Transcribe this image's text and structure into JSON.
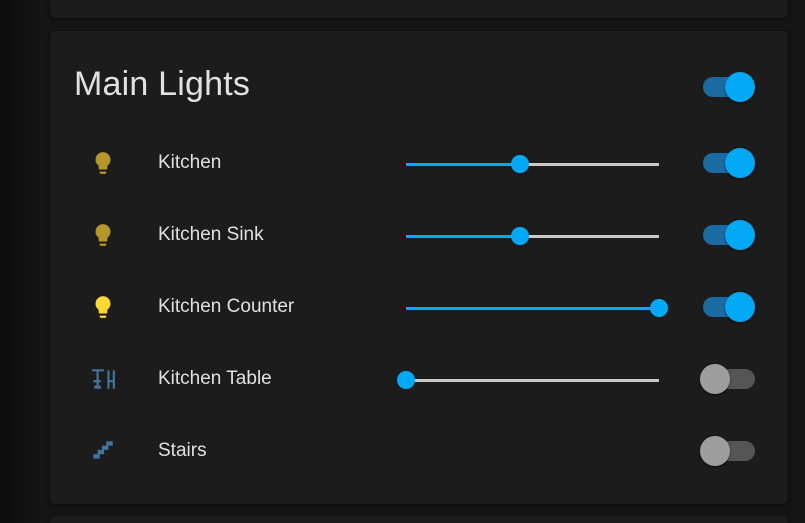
{
  "card": {
    "title": "Main Lights",
    "master_toggle_on": true
  },
  "rows": [
    {
      "label": "Kitchen",
      "icon": "lightbulb-icon",
      "icon_color": "#b8972a",
      "has_slider": true,
      "brightness_pct": 45,
      "on": true
    },
    {
      "label": "Kitchen Sink",
      "icon": "lightbulb-icon",
      "icon_color": "#b8972a",
      "has_slider": true,
      "brightness_pct": 45,
      "on": true
    },
    {
      "label": "Kitchen Counter",
      "icon": "lightbulb-icon",
      "icon_color": "#fdd835",
      "has_slider": true,
      "brightness_pct": 100,
      "on": true
    },
    {
      "label": "Kitchen Table",
      "icon": "table-chair-icon",
      "icon_color": "#44739e",
      "has_slider": true,
      "brightness_pct": 0,
      "on": false
    },
    {
      "label": "Stairs",
      "icon": "stairs-icon",
      "icon_color": "#44739e",
      "has_slider": false,
      "on": false
    }
  ],
  "colors": {
    "accent": "#03a9f4",
    "track_on": "#1b6aa1",
    "track_off": "#555555",
    "thumb_off": "#9e9e9e",
    "card_bg": "#1c1c1c",
    "text": "#e1e1e1"
  }
}
